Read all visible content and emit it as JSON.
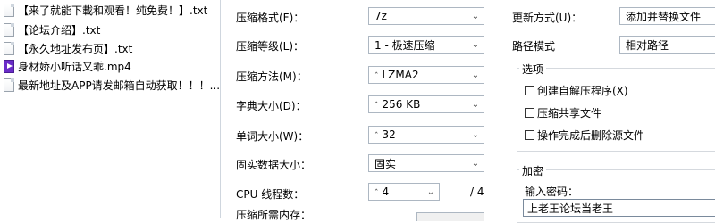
{
  "files": [
    {
      "name": "【来了就能下載和观看！纯免费！】.txt",
      "icon": "text-file-icon"
    },
    {
      "name": "【论坛介绍】.txt",
      "icon": "text-file-icon"
    },
    {
      "name": "【永久地址发布页】.txt",
      "icon": "text-file-icon"
    },
    {
      "name": "身材娇小听话又乖.mp4",
      "icon": "mp4-file-icon"
    },
    {
      "name": "最新地址及APP请发邮箱自动获取！！！....",
      "icon": "text-file-icon"
    }
  ],
  "settings": {
    "format_label": "压缩格式(F)：",
    "format_value": "7z",
    "level_label": "压缩等级(L)：",
    "level_value": "1 - 极速压缩",
    "method_label": "压缩方法(M)：",
    "method_value": "LZMA2",
    "dict_label": "字典大小(D)：",
    "dict_value": "256 KB",
    "word_label": "单词大小(W)：",
    "word_value": "32",
    "solid_label": "固实数据大小：",
    "solid_value": "固实",
    "cpu_label": "CPU 线程数：",
    "cpu_value": "4",
    "cpu_total": "/ 4",
    "memory_label": "压缩所需内存："
  },
  "right": {
    "update_label": "更新方式(U)：",
    "update_value": "添加并替换文件",
    "path_label": "路径模式",
    "path_value": "相对路径",
    "options_title": "选项",
    "options": [
      {
        "label": "创建自解压程序(X)",
        "checked": false
      },
      {
        "label": "压缩共享文件",
        "checked": false
      },
      {
        "label": "操作完成后删除源文件",
        "checked": false
      }
    ],
    "encryption_title": "加密",
    "password_label": "输入密码：",
    "password_value": "上老王论坛当老王"
  },
  "icons": {
    "dropdown": "chevron-down-icon",
    "spin": "spin-caret-icon"
  }
}
